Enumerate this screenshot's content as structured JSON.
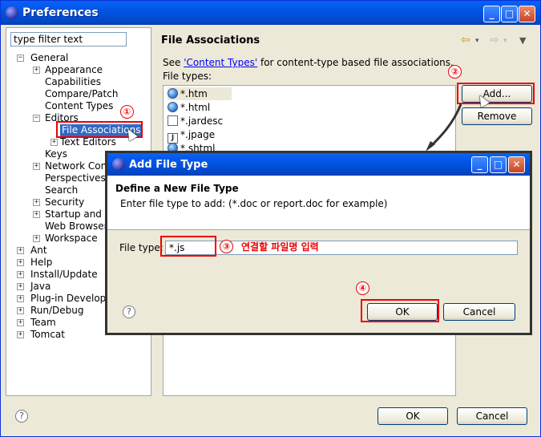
{
  "window": {
    "title": "Preferences",
    "controls": {
      "minimize": "_",
      "maximize": "□",
      "close": "✕"
    }
  },
  "filter": {
    "value": "type filter text"
  },
  "tree": {
    "nodes": [
      {
        "label": "General",
        "exp": "−"
      },
      {
        "label": "Appearance",
        "exp": "+"
      },
      {
        "label": "Capabilities",
        "exp": ""
      },
      {
        "label": "Compare/Patch",
        "exp": ""
      },
      {
        "label": "Content Types",
        "exp": ""
      },
      {
        "label": "Editors",
        "exp": "−"
      },
      {
        "label": "File Associations",
        "exp": ""
      },
      {
        "label": "Text Editors",
        "exp": "+"
      },
      {
        "label": "Keys",
        "exp": ""
      },
      {
        "label": "Network Conn",
        "exp": "+"
      },
      {
        "label": "Perspectives",
        "exp": ""
      },
      {
        "label": "Search",
        "exp": ""
      },
      {
        "label": "Security",
        "exp": "+"
      },
      {
        "label": "Startup and S",
        "exp": "+"
      },
      {
        "label": "Web Browser",
        "exp": ""
      },
      {
        "label": "Workspace",
        "exp": "+"
      },
      {
        "label": "Ant",
        "exp": "+"
      },
      {
        "label": "Help",
        "exp": "+"
      },
      {
        "label": "Install/Update",
        "exp": "+"
      },
      {
        "label": "Java",
        "exp": "+"
      },
      {
        "label": "Plug-in Developm",
        "exp": "+"
      },
      {
        "label": "Run/Debug",
        "exp": "+"
      },
      {
        "label": "Team",
        "exp": "+"
      },
      {
        "label": "Tomcat",
        "exp": "+"
      }
    ]
  },
  "page": {
    "title": "File Associations",
    "see_prefix": "See ",
    "see_link": "'Content Types'",
    "see_suffix": " for content-type based file associations.",
    "file_types_label": "File types:",
    "file_types": [
      {
        "name": "*.htm",
        "icon": "globe"
      },
      {
        "name": "*.html",
        "icon": "globe"
      },
      {
        "name": "*.jardesc",
        "icon": "doc"
      },
      {
        "name": "*.jpage",
        "icon": "jfile"
      },
      {
        "name": "*.shtml",
        "icon": "globe"
      }
    ],
    "add_label": "Add...",
    "remove_label": "Remove"
  },
  "footer": {
    "ok": "OK",
    "cancel": "Cancel",
    "help": "?"
  },
  "dialog": {
    "title": "Add File Type",
    "heading": "Define a New File Type",
    "description": "Enter file type to add: (*.doc or report.doc for example)",
    "field_label": "File type:",
    "field_value": "*.js",
    "ok": "OK",
    "cancel": "Cancel",
    "help": "?"
  },
  "annotations": {
    "step1": "①",
    "step2": "②",
    "step3": "③",
    "step4": "④",
    "step3_text": "연결할 파일명 입력",
    "color": "#e00000"
  },
  "nav": {
    "back": "⇦",
    "back_menu": "▾",
    "forward": "⇨",
    "forward_menu": "▾",
    "view_menu": "▼"
  }
}
